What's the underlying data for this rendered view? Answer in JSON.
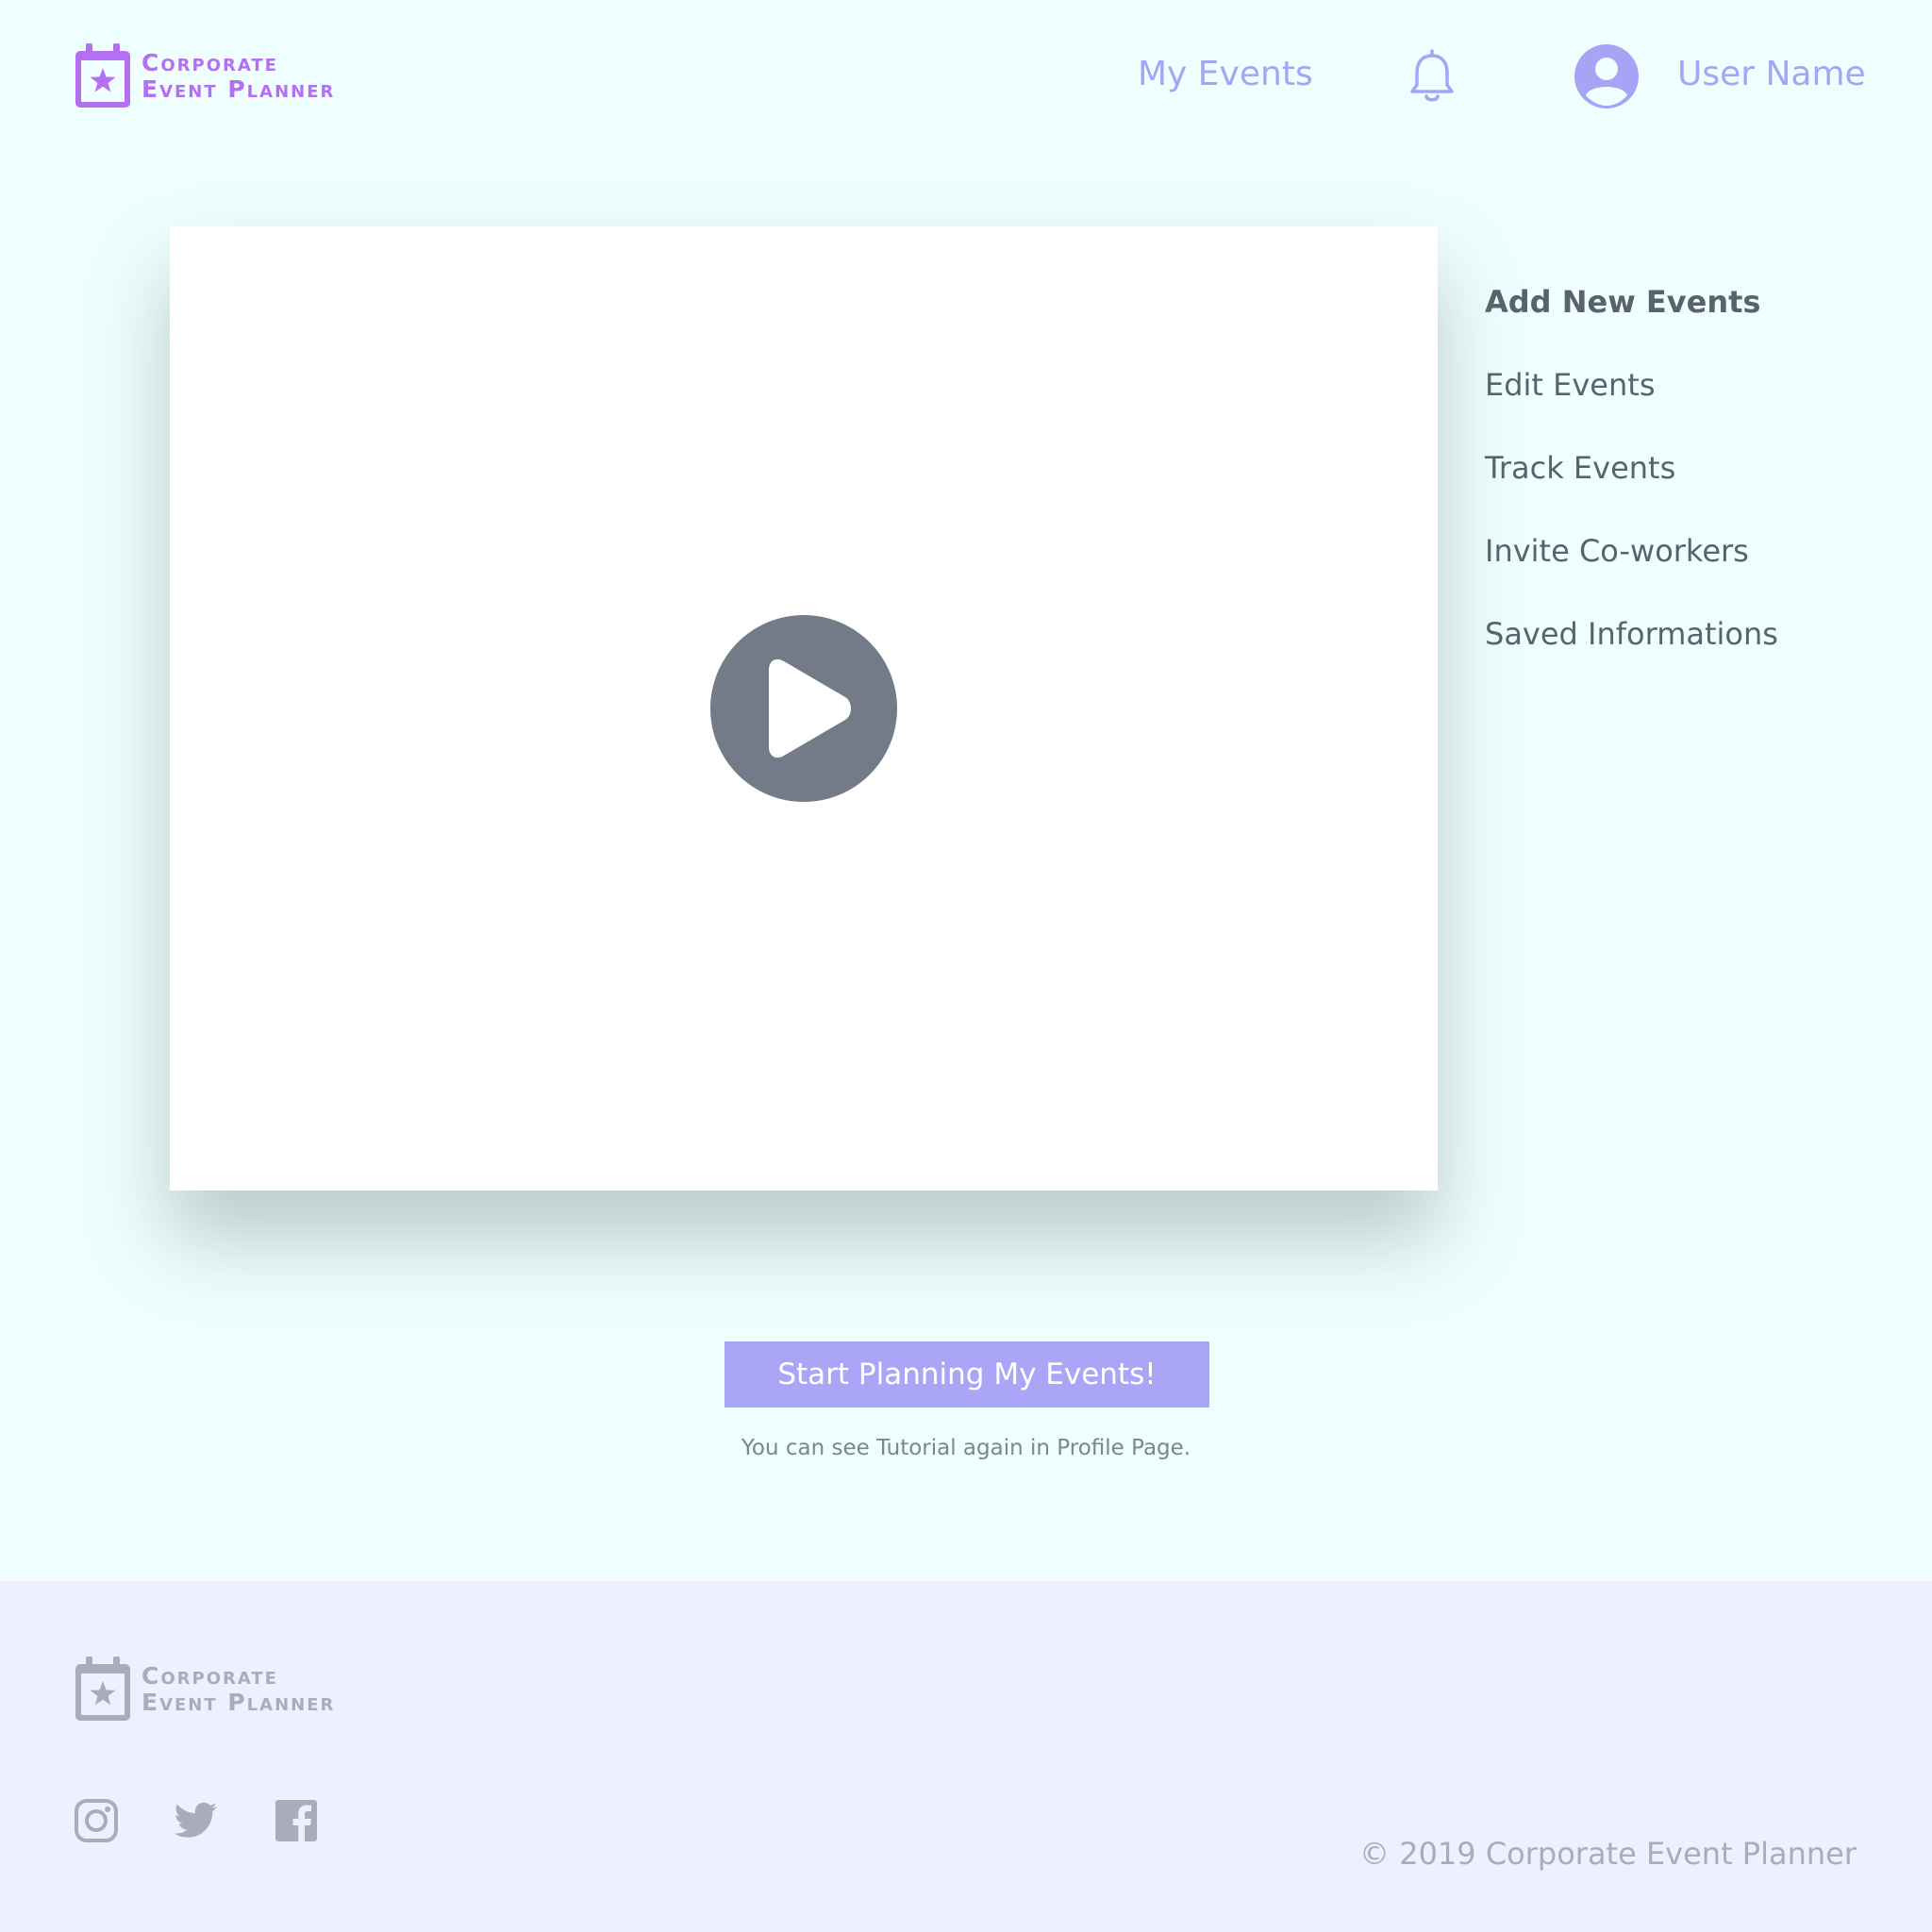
{
  "brand": {
    "line1": "Corporate",
    "line2": "Event Planner",
    "logo_icon": "calendar-star-icon",
    "color": "#b46ff2"
  },
  "header": {
    "my_events": "My Events",
    "bell_icon": "bell-icon",
    "avatar_icon": "user-avatar-icon",
    "user_name": "User Name",
    "nav_color": "#a7a3f5"
  },
  "video": {
    "play_icon": "play-icon"
  },
  "side_menu": {
    "items": [
      {
        "label": "Add New Events",
        "active": true
      },
      {
        "label": "Edit Events",
        "active": false
      },
      {
        "label": "Track Events",
        "active": false
      },
      {
        "label": "Invite Co-workers",
        "active": false
      },
      {
        "label": "Saved Informations",
        "active": false
      }
    ]
  },
  "cta": {
    "label": "Start Planning My Events!",
    "hint": "You can see Tutorial again in Profile Page.",
    "color": "#aba5f7"
  },
  "footer": {
    "brand_line1": "Corporate",
    "brand_line2": "Event Planner",
    "social_icons": [
      "instagram-icon",
      "twitter-icon",
      "facebook-icon"
    ],
    "copyright": "© 2019 Corporate Event Planner",
    "background": "#eff0fd"
  },
  "colors": {
    "page_background": "#effefe",
    "muted": "#a9adbb",
    "text": "#5a626c"
  }
}
